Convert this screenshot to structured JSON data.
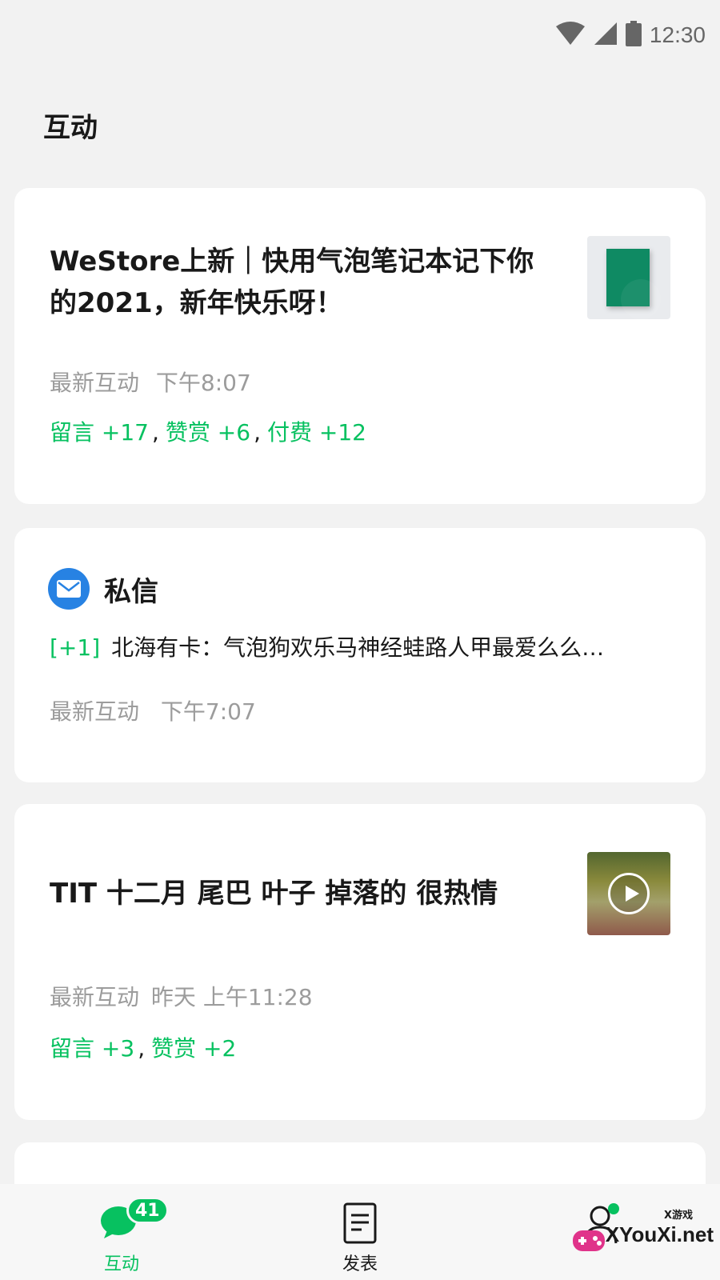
{
  "status_bar": {
    "time": "12:30",
    "icons": [
      "wifi-icon",
      "cellular-signal-icon",
      "battery-icon"
    ]
  },
  "page": {
    "title": "互动"
  },
  "cards": {
    "article1": {
      "title": "WeStore上新｜快用气泡笔记本记下你的2021，新年快乐呀！",
      "meta_label": "最新互动",
      "meta_time": "下午8:07",
      "stats": [
        {
          "label": "留言 +17"
        },
        {
          "label": "赞赏 +6"
        },
        {
          "label": "付费 +12"
        }
      ],
      "thumbnail": "notebook-thumbnail"
    },
    "private_message": {
      "title": "私信",
      "count": "[+1]",
      "sender": "北海有卡：",
      "preview": "气泡狗欢乐马神经蛙路人甲最爱么么…",
      "meta_label": "最新互动",
      "meta_time": "下午7:07",
      "icon": "mail-icon"
    },
    "article2": {
      "title": "TIT 十二月 尾巴 叶子 掉落的 很热情",
      "meta_label": "最新互动",
      "meta_time": "昨天 上午11:28",
      "stats": [
        {
          "label": "留言 +3"
        },
        {
          "label": "赞赏 +2"
        }
      ],
      "thumbnail": "video-thumbnail"
    }
  },
  "tab_bar": {
    "tabs": [
      {
        "label": "互动",
        "icon": "chat-bubble-icon",
        "badge": "41",
        "active": true
      },
      {
        "label": "发表",
        "icon": "document-icon"
      },
      {
        "label": "",
        "icon": "profile-icon"
      }
    ]
  },
  "watermark": {
    "small": "X游戏",
    "text": "XYouXi.net"
  },
  "colors": {
    "accent": "#07c160",
    "mail_blue": "#2782e3",
    "background": "#f2f2f2",
    "meta_gray": "#9c9c9c"
  }
}
